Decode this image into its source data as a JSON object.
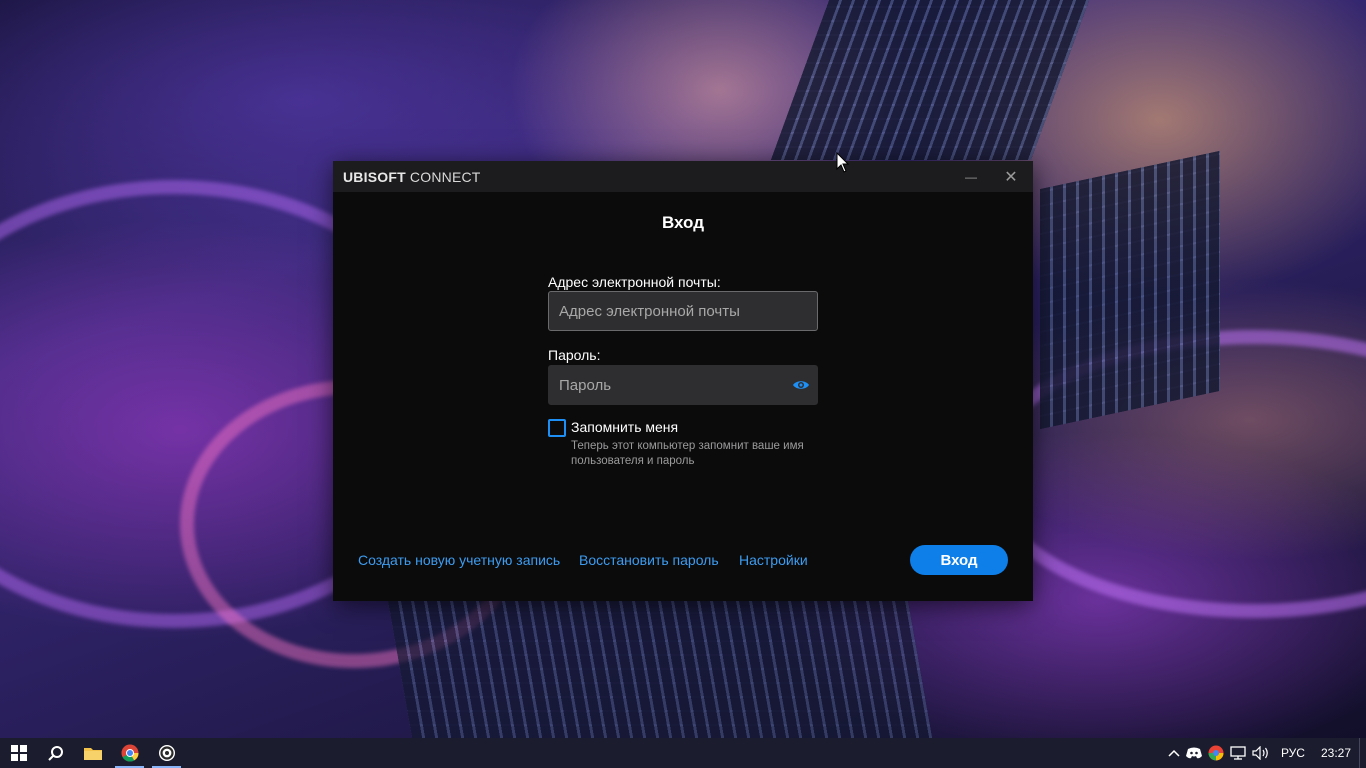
{
  "window": {
    "brand_bold": "UBISOFT",
    "brand_rest": " CONNECT",
    "minimize_glyph": "—",
    "close_glyph": "✕"
  },
  "login": {
    "heading": "Вход",
    "email_label": "Адрес электронной почты:",
    "email_placeholder": "Адрес электронной почты",
    "email_value": "",
    "password_label": "Пароль:",
    "password_placeholder": "Пароль",
    "password_value": "",
    "remember_label": "Запомнить меня",
    "remember_checked": false,
    "remember_note": "Теперь этот компьютер запомнит ваше имя пользователя и пароль",
    "submit_label": "Вход"
  },
  "links": {
    "create_account": "Создать новую учетную запись",
    "restore_password": "Восстановить пароль",
    "settings": "Настройки"
  },
  "taskbar": {
    "pinned": [
      "windows-start",
      "search",
      "file-explorer",
      "chrome",
      "ubisoft-connect"
    ],
    "tray": {
      "language": "РУС",
      "time": "23:27"
    }
  },
  "colors": {
    "accent": "#0e7fe8",
    "link": "#3d9cf0",
    "window_bg": "#0b0b0c",
    "titlebar_bg": "#1c1c1e"
  }
}
